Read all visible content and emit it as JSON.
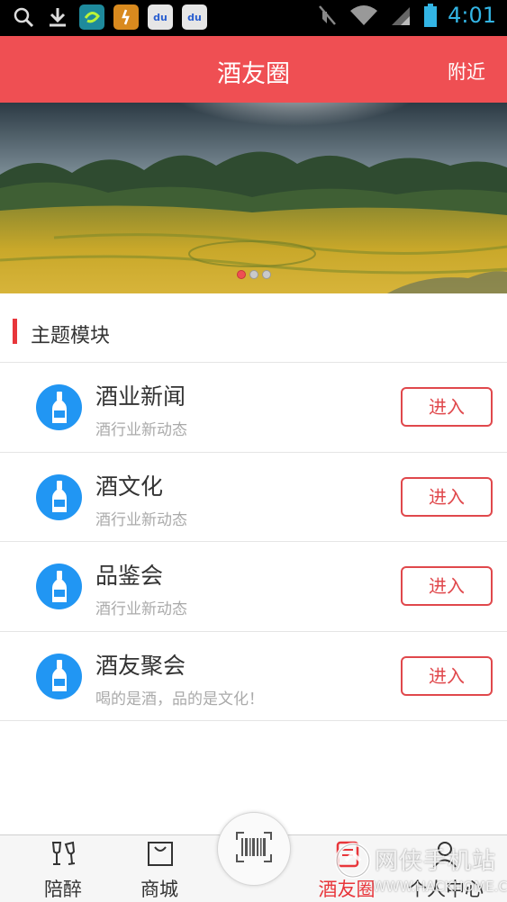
{
  "status_bar": {
    "time": "4:01",
    "left_icons": [
      "search-icon",
      "download-icon",
      "app-green-icon",
      "app-orange-icon",
      "baidu-icon",
      "baidu-icon"
    ],
    "baidu_label": "du",
    "right_icons": [
      "mute-icon",
      "wifi-icon",
      "signal-icon",
      "battery-icon"
    ]
  },
  "header": {
    "title": "酒友圈",
    "right_action": "附近",
    "bg_color": "#ef4f53"
  },
  "banner": {
    "slide_count": 3,
    "active_slide": 0
  },
  "section": {
    "title": "主题模块"
  },
  "modules": [
    {
      "title": "酒业新闻",
      "subtitle": "酒行业新动态",
      "button": "进入",
      "icon": "wine-bottle-icon"
    },
    {
      "title": "酒文化",
      "subtitle": "酒行业新动态",
      "button": "进入",
      "icon": "wine-bottle-icon"
    },
    {
      "title": "品鉴会",
      "subtitle": "酒行业新动态",
      "button": "进入",
      "icon": "wine-bottle-icon"
    },
    {
      "title": "酒友聚会",
      "subtitle": "喝的是酒，品的是文化！",
      "button": "进入",
      "icon": "wine-bottle-icon"
    }
  ],
  "bottom_nav": {
    "items": [
      {
        "label": "陪醉",
        "icon": "wine-glasses-icon",
        "active": false
      },
      {
        "label": "商城",
        "icon": "shopping-bag-icon",
        "active": false
      },
      {
        "label": "",
        "icon": "barcode-scan-icon",
        "active": false
      },
      {
        "label": "酒友圈",
        "icon": "moments-icon",
        "active": true
      },
      {
        "label": "个人中心",
        "icon": "user-icon",
        "active": false
      }
    ]
  },
  "watermark": {
    "text": "网侠手机站",
    "url": "WWW.HACKHOME.COM"
  },
  "colors": {
    "accent": "#ef4f53",
    "module_icon": "#2196f3",
    "button_border": "#e0484c"
  }
}
